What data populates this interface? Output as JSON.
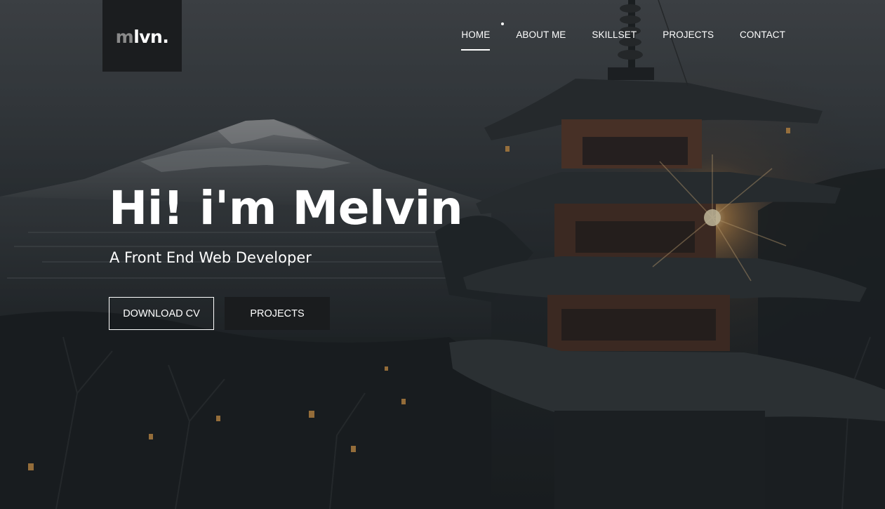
{
  "logo": {
    "prefix": "m",
    "rest": "lvn."
  },
  "nav": {
    "items": [
      {
        "label": "HOME",
        "active": true
      },
      {
        "label": "ABOUT ME",
        "active": false
      },
      {
        "label": "SKILLSET",
        "active": false
      },
      {
        "label": "PROJECTS",
        "active": false
      },
      {
        "label": "CONTACT",
        "active": false
      }
    ]
  },
  "hero": {
    "title": "Hi! i'm Melvin",
    "subtitle": "A Front End Web Developer",
    "buttons": {
      "download_cv": "DOWNLOAD CV",
      "projects": "PROJECTS"
    }
  },
  "colors": {
    "logo_bg": "#1b1d1f",
    "logo_m": "#8a8a8a",
    "text": "#ffffff",
    "dark_button": "#1a1c1e"
  }
}
